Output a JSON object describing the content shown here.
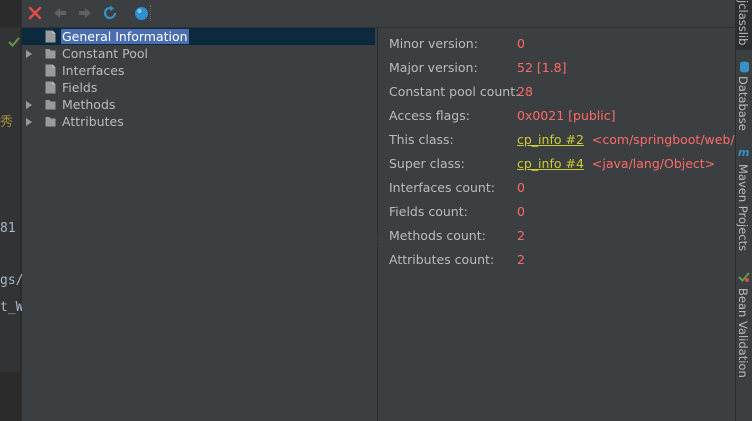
{
  "toolbar": {
    "close_icon": "close-icon",
    "back_icon": "back-icon",
    "forward_icon": "forward-icon",
    "refresh_icon": "refresh-icon",
    "web_icon": "globe-icon",
    "accent_close": "#e54b4b",
    "accent_refresh": "#3592c4"
  },
  "tree": {
    "items": [
      {
        "label": "General Information",
        "type": "file",
        "expandable": false,
        "selected": true
      },
      {
        "label": "Constant Pool",
        "type": "folder",
        "expandable": true,
        "selected": false
      },
      {
        "label": "Interfaces",
        "type": "file",
        "expandable": false,
        "selected": false
      },
      {
        "label": "Fields",
        "type": "file",
        "expandable": false,
        "selected": false
      },
      {
        "label": "Methods",
        "type": "folder",
        "expandable": true,
        "selected": false
      },
      {
        "label": "Attributes",
        "type": "folder",
        "expandable": true,
        "selected": false
      }
    ]
  },
  "details": {
    "rows": [
      {
        "label": "Minor version:",
        "value": "0"
      },
      {
        "label": "Major version:",
        "value": "52 [1.8]"
      },
      {
        "label": "Constant pool count:",
        "value": "28"
      },
      {
        "label": "Access flags:",
        "value": "0x0021 [public]"
      },
      {
        "label": "This class:",
        "link": "cp_info #2",
        "extra": "<com/springboot/web/demo"
      },
      {
        "label": "Super class:",
        "link": "cp_info #4",
        "extra": "<java/lang/Object>"
      },
      {
        "label": "Interfaces count:",
        "value": "0"
      },
      {
        "label": "Fields count:",
        "value": "0"
      },
      {
        "label": "Methods count:",
        "value": "2"
      },
      {
        "label": "Attributes count:",
        "value": "2"
      }
    ]
  },
  "editor_fragments": [
    "秀",
    "81",
    "gs/",
    "t_W"
  ],
  "right_tabs": [
    {
      "label": "jclasslib",
      "icon": "jclasslib-icon"
    },
    {
      "label": "Database",
      "icon": "database-icon"
    },
    {
      "label": "Maven Projects",
      "icon": "maven-icon"
    },
    {
      "label": "Bean Validation",
      "icon": "bean-validation-icon"
    }
  ],
  "colors": {
    "value": "#ff6b68",
    "link": "#cccc33",
    "selection": "#4b6eaf",
    "panel": "#3c3f41"
  }
}
